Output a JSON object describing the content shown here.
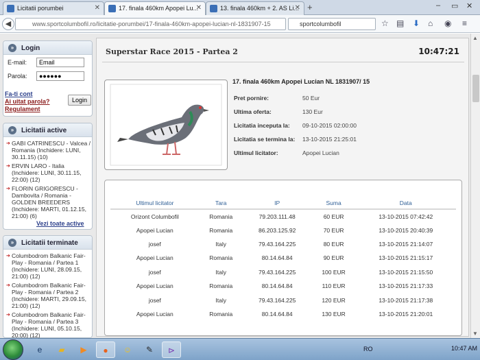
{
  "browser": {
    "tabs": [
      {
        "label": "Licitatii porumbei"
      },
      {
        "label": "17. finala 460km Apopei Lu..."
      },
      {
        "label": "13. finala 460km + 2. AS Li..."
      }
    ],
    "url": "www.sportcolumbofil.ro/licitatie-porumbei/17-finala-460km-apopei-lucian-nl-1831907-15",
    "search_value": "sportcolumbofil",
    "new_tab": "+"
  },
  "login": {
    "title": "Login",
    "email_label": "E-mail:",
    "email_value": "Email",
    "password_label": "Parola:",
    "password_value": "●●●●●●",
    "create_account": "Fa-ti cont",
    "forgot_password": "Ai uitat parola?",
    "rules": "Regulament",
    "login_button": "Login"
  },
  "active_auctions": {
    "title": "Licitatii active",
    "items": [
      {
        "text": "GABI CATRINESCU - Valcea / Romania (Inchidere: LUNI, 30.11.15) (10)"
      },
      {
        "text": "ERVIN LARO - Italia (Inchidere: LUNI, 30.11.15, 22:00) (12)"
      },
      {
        "text": "FLORIN GRIGORESCU - Dambovita / Romania - GOLDEN BREEDERS (Inchidere: MARTI, 01.12.15, 21:00) (6)"
      }
    ],
    "view_all": "Vezi toate active"
  },
  "ended_auctions": {
    "title": "Licitatii terminate",
    "items": [
      {
        "text": "Columbodrom Balkanic Fair-Play - Romania / Partea 1 (Inchidere: LUNI, 28.09.15, 21:00) (12)"
      },
      {
        "text": "Columbodrom Balkanic Fair-Play - Romania / Partea 2 (Inchidere: MARTI, 29.09.15, 21:00) (12)"
      },
      {
        "text": "Columbodrom Balkanic Fair-Play - Romania / Partea 3 (Inchidere: LUNI, 05.10.15, 20:00) (12)"
      }
    ]
  },
  "main": {
    "title": "Superstar Race 2015 - Partea 2",
    "clock": "10:47:21",
    "lot_title": "17. finala 460km Apopei Lucian NL 1831907/ 15",
    "details": [
      {
        "key": "Pret pornire:",
        "value": "50 Eur"
      },
      {
        "key": "Ultima oferta:",
        "value": "130 Eur"
      },
      {
        "key": "Licitatia inceputa la:",
        "value": "09-10-2015 02:00:00"
      },
      {
        "key": "Licitatia se termina la:",
        "value": "13-10-2015 21:25:01"
      },
      {
        "key": "Ultimul licitator:",
        "value": "Apopei Lucian"
      }
    ],
    "bids_headers": [
      "Ultimul licitator",
      "Tara",
      "IP",
      "Suma",
      "Data"
    ],
    "bids": [
      [
        "Orizont Columbofil",
        "Romania",
        "79.203.111.48",
        "60 EUR",
        "13-10-2015 07:42:42"
      ],
      [
        "Apopei Lucian",
        "Romania",
        "86.203.125.92",
        "70 EUR",
        "13-10-2015 20:40:39"
      ],
      [
        "josef",
        "Italy",
        "79.43.164.225",
        "80 EUR",
        "13-10-2015 21:14:07"
      ],
      [
        "Apopei Lucian",
        "Romania",
        "80.14.64.84",
        "90 EUR",
        "13-10-2015 21:15:17"
      ],
      [
        "josef",
        "Italy",
        "79.43.164.225",
        "100 EUR",
        "13-10-2015 21:15:50"
      ],
      [
        "Apopei Lucian",
        "Romania",
        "80.14.64.84",
        "110 EUR",
        "13-10-2015 21:17:33"
      ],
      [
        "josef",
        "Italy",
        "79.43.164.225",
        "120 EUR",
        "13-10-2015 21:17:38"
      ],
      [
        "Apopei Lucian",
        "Romania",
        "80.14.64.84",
        "130 EUR",
        "13-10-2015 21:20:01"
      ]
    ]
  },
  "taskbar": {
    "lang": "RO",
    "time": "10:47 AM"
  }
}
